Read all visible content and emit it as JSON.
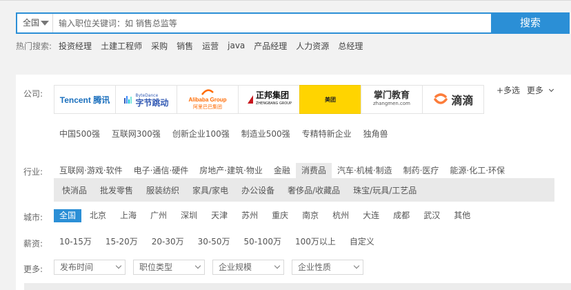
{
  "search": {
    "city": "全国",
    "placeholder": "输入职位关键词：如 销售总监等",
    "button_label": "搜索"
  },
  "hot_search": {
    "label": "热门搜索:",
    "keywords": [
      "投资经理",
      "土建工程师",
      "采购",
      "销售",
      "运营",
      "java",
      "产品经理",
      "人力资源",
      "总经理"
    ]
  },
  "company": {
    "label": "公司:",
    "logos": [
      {
        "name": "Tencent 腾讯",
        "color": "#1a6fbd"
      },
      {
        "name": "字节跳动",
        "sub": "ByteDance",
        "color": "#325ab4"
      },
      {
        "name": "Alibaba Group",
        "sub": "阿里巴巴集团",
        "color": "#ff6a00"
      },
      {
        "name": "正邦集团",
        "sub": "ZHENGBANG GROUP",
        "color": "#c8161d"
      },
      {
        "name": "美团",
        "color": "#222222"
      },
      {
        "name": "掌门教育",
        "sub": "zhangmen.com",
        "color": "#333333"
      },
      {
        "name": "滴滴",
        "color": "#fc7d3b"
      }
    ],
    "more_select": "+多选",
    "more": "更多",
    "tags": [
      "中国500强",
      "互联网300强",
      "创新企业100强",
      "制造业500强",
      "专精特新企业",
      "独角兽"
    ]
  },
  "industry": {
    "label": "行业:",
    "items": [
      "互联网·游戏·软件",
      "电子·通信·硬件",
      "房地产·建筑·物业",
      "金融",
      "消费品",
      "汽车·机械·制造",
      "制药·医疗",
      "能源·化工·环保"
    ],
    "active": "消费品",
    "sub_items": [
      "快消品",
      "批发零售",
      "服装纺织",
      "家具/家电",
      "办公设备",
      "奢侈品/收藏品",
      "珠宝/玩具/工艺品"
    ]
  },
  "city": {
    "label": "城市:",
    "items": [
      "全国",
      "北京",
      "上海",
      "广州",
      "深圳",
      "天津",
      "苏州",
      "重庆",
      "南京",
      "杭州",
      "大连",
      "成都",
      "武汉",
      "其他"
    ],
    "active": "全国"
  },
  "salary": {
    "label": "薪资:",
    "items": [
      "10-15万",
      "15-20万",
      "20-30万",
      "30-50万",
      "50-100万",
      "100万以上",
      "自定义"
    ]
  },
  "more": {
    "label": "更多:",
    "dropdowns": [
      "发布时间",
      "职位类型",
      "企业规模",
      "企业性质"
    ]
  },
  "colors": {
    "accent": "#2b8fd6",
    "meituan_yellow": "#ffd400"
  }
}
